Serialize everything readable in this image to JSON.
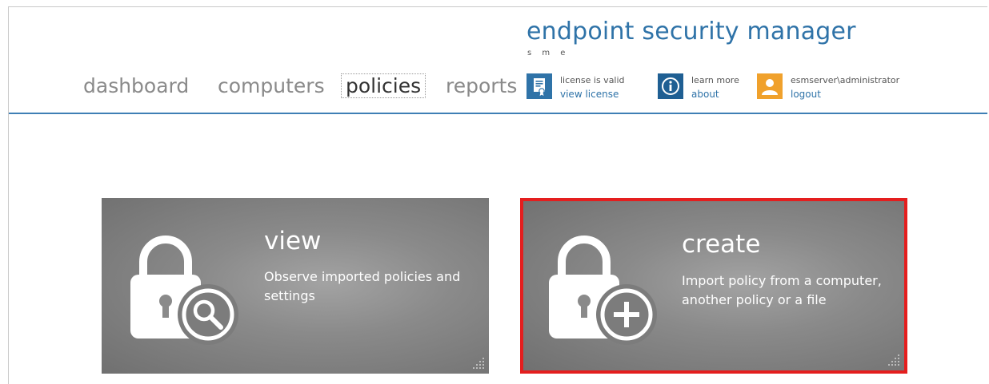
{
  "header": {
    "title": "endpoint security manager",
    "subtitle": "s m e"
  },
  "nav": {
    "items": [
      {
        "label": "dashboard"
      },
      {
        "label": "computers"
      },
      {
        "label": "policies",
        "active": true
      },
      {
        "label": "reports"
      }
    ]
  },
  "account": {
    "license": {
      "line1": "license is valid",
      "link": "view license",
      "icon": "license-certificate-icon"
    },
    "info": {
      "line1": "learn more",
      "link": "about",
      "icon": "info-icon"
    },
    "user": {
      "line1": "esmserver\\administrator",
      "link": "logout",
      "icon": "user-icon"
    }
  },
  "tiles": [
    {
      "title": "view",
      "description": "Observe imported policies and settings",
      "icon": "lock-search-icon",
      "selected": false
    },
    {
      "title": "create",
      "description": "Import policy from a computer, another policy or a file",
      "icon": "lock-add-icon",
      "selected": true
    }
  ],
  "colors": {
    "accent": "#2f73a8",
    "license_icon": "#2f73a8",
    "info_icon": "#1f5f93",
    "user_icon": "#f0a12c",
    "selection_border": "#e41e1e",
    "tile_bg": "#8a8a8a"
  }
}
